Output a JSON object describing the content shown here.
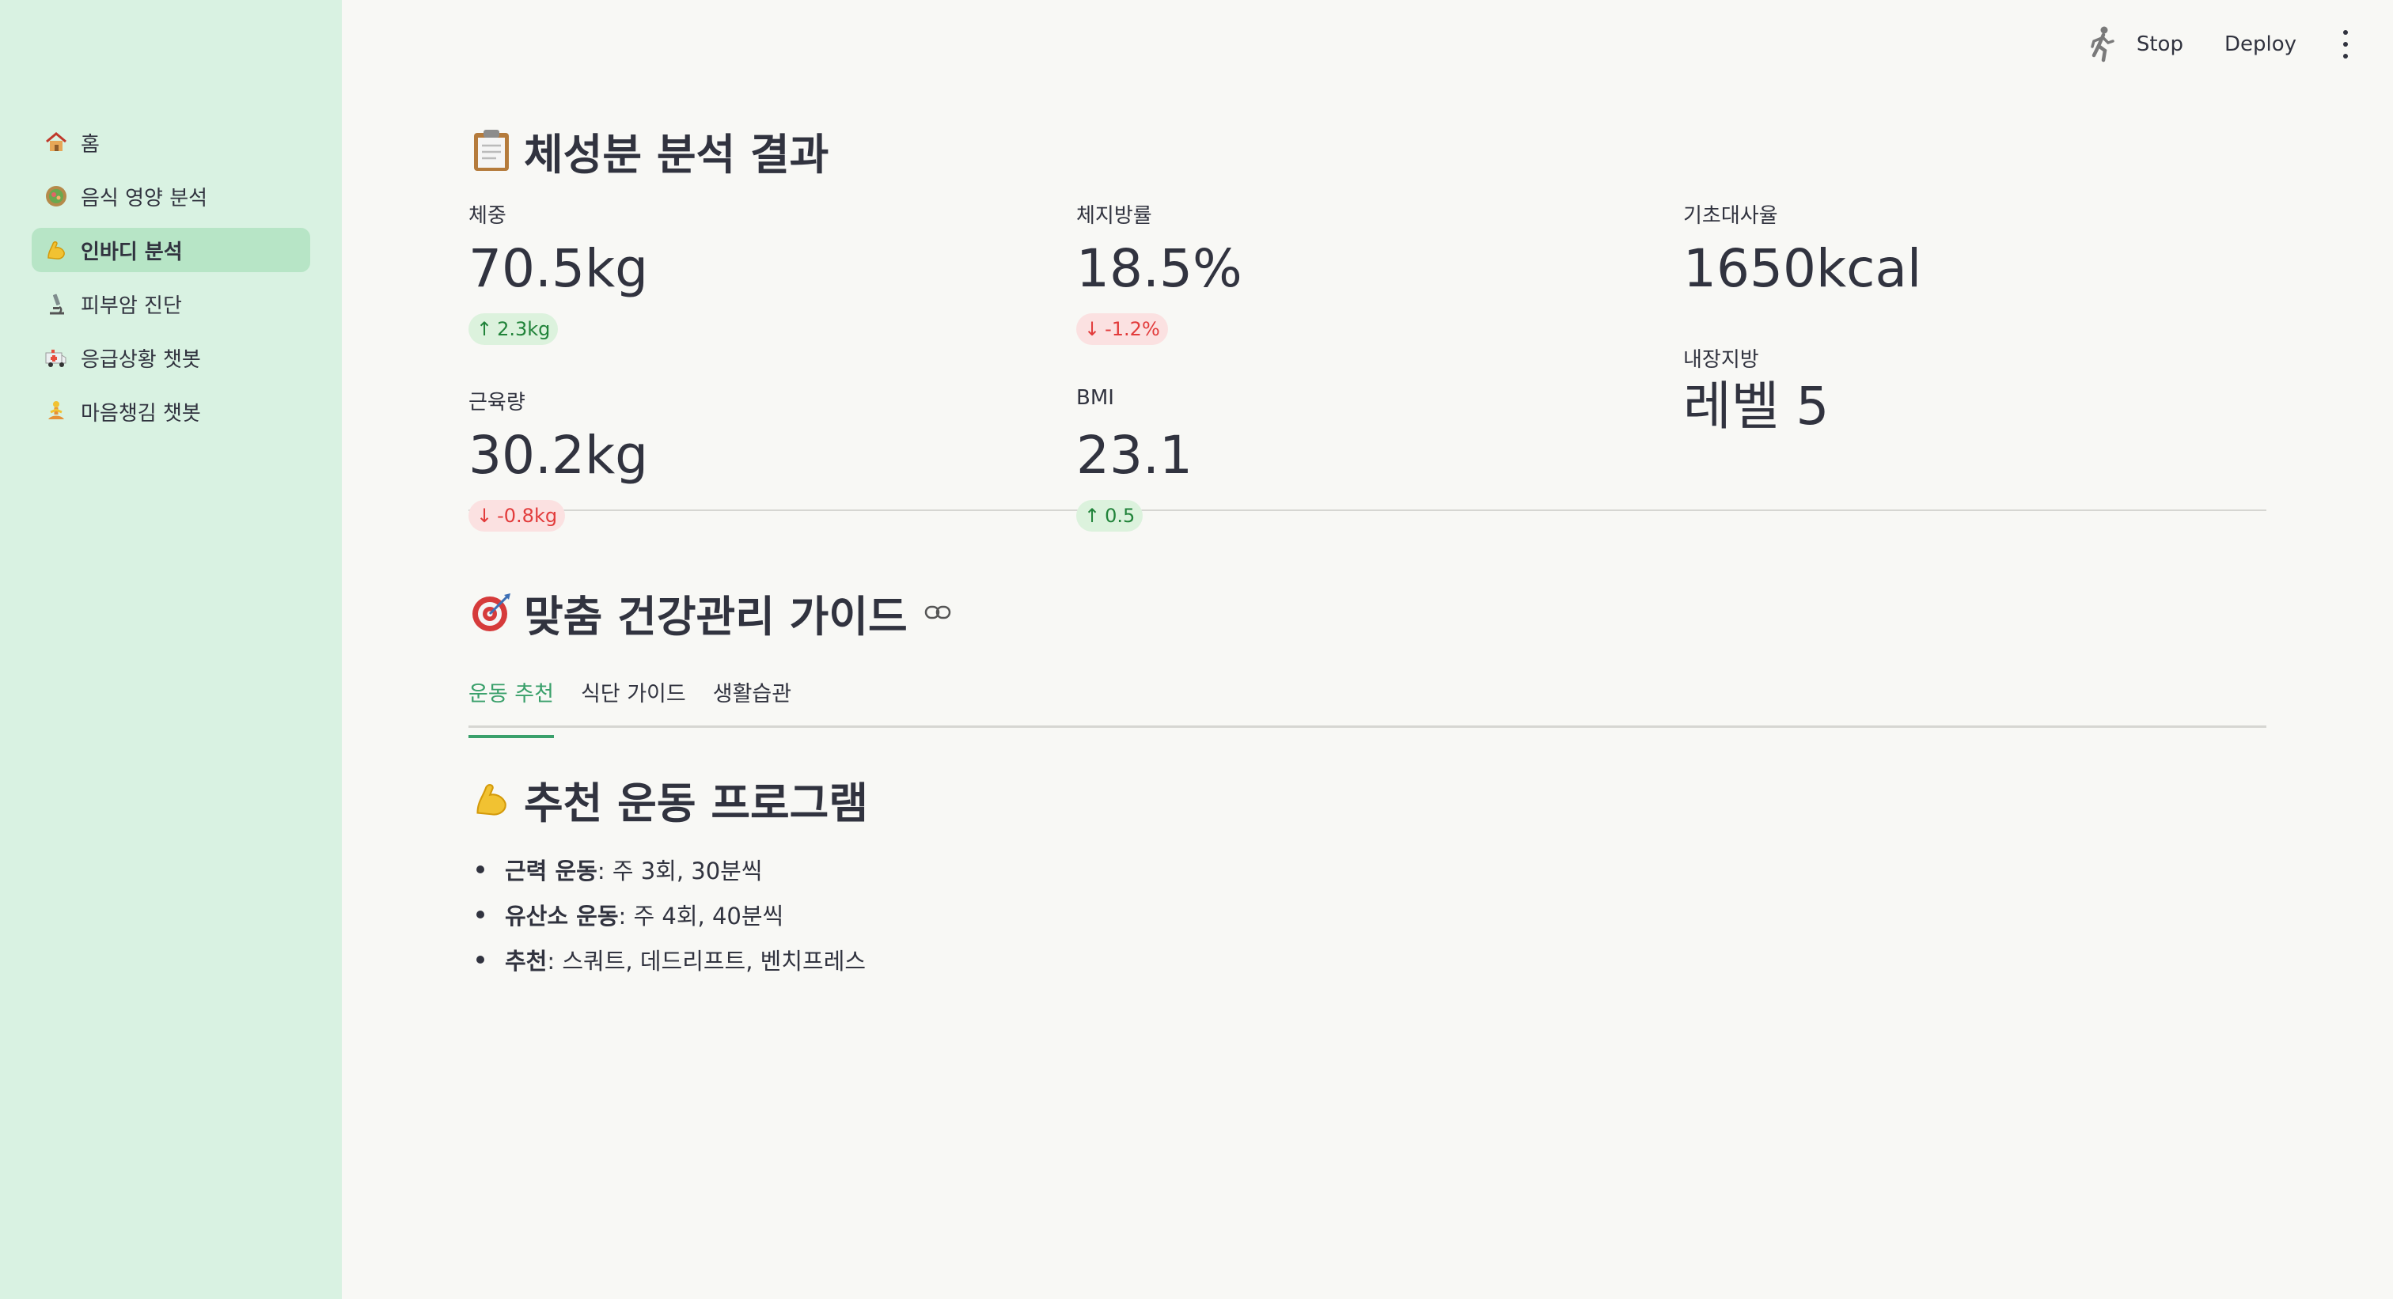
{
  "toolbar": {
    "stop_label": "Stop",
    "deploy_label": "Deploy"
  },
  "sidebar": {
    "items": [
      {
        "label": "홈",
        "icon": "house-icon",
        "active": false
      },
      {
        "label": "음식 영양 분석",
        "icon": "salad-icon",
        "active": false
      },
      {
        "label": "인바디 분석",
        "icon": "flexed-biceps-icon",
        "active": true
      },
      {
        "label": "피부암 진단",
        "icon": "microscope-icon",
        "active": false
      },
      {
        "label": "응급상황 챗봇",
        "icon": "ambulance-icon",
        "active": false
      },
      {
        "label": "마음챙김 챗봇",
        "icon": "meditation-icon",
        "active": false
      }
    ]
  },
  "results": {
    "title": "체성분 분석 결과",
    "icon": "clipboard-icon",
    "metrics": {
      "weight": {
        "label": "체중",
        "value": "70.5kg",
        "delta": "2.3kg",
        "direction": "up"
      },
      "body_fat": {
        "label": "체지방률",
        "value": "18.5%",
        "delta": "-1.2%",
        "direction": "down"
      },
      "bmr": {
        "label": "기초대사율",
        "value": "1650kcal"
      },
      "muscle": {
        "label": "근육량",
        "value": "30.2kg",
        "delta": "-0.8kg",
        "direction": "down"
      },
      "bmi": {
        "label": "BMI",
        "value": "23.1",
        "delta": "0.5",
        "direction": "up"
      },
      "visceral_fat": {
        "label": "내장지방",
        "value": "레벨 5"
      }
    }
  },
  "guide": {
    "title": "맞춤 건강관리 가이드",
    "icon": "target-icon",
    "tabs": [
      "운동 추천",
      "식단 가이드",
      "생활습관"
    ],
    "active_tab": 0,
    "program": {
      "title": "추천 운동 프로그램",
      "icon": "flexed-biceps-icon",
      "items": [
        {
          "label": "근력 운동",
          "text": ": 주 3회, 30분씩"
        },
        {
          "label": "유산소 운동",
          "text": ": 주 4회, 40분씩"
        },
        {
          "label": "추천",
          "text": ": 스쿼트, 데드리프트, 벤치프레스"
        }
      ]
    }
  },
  "colors": {
    "sidebar_bg": "#d9f2e2",
    "sidebar_active": "#b7e5c6",
    "accent": "#3aa06b",
    "delta_up": "#21833a",
    "delta_down": "#e23b3b"
  }
}
